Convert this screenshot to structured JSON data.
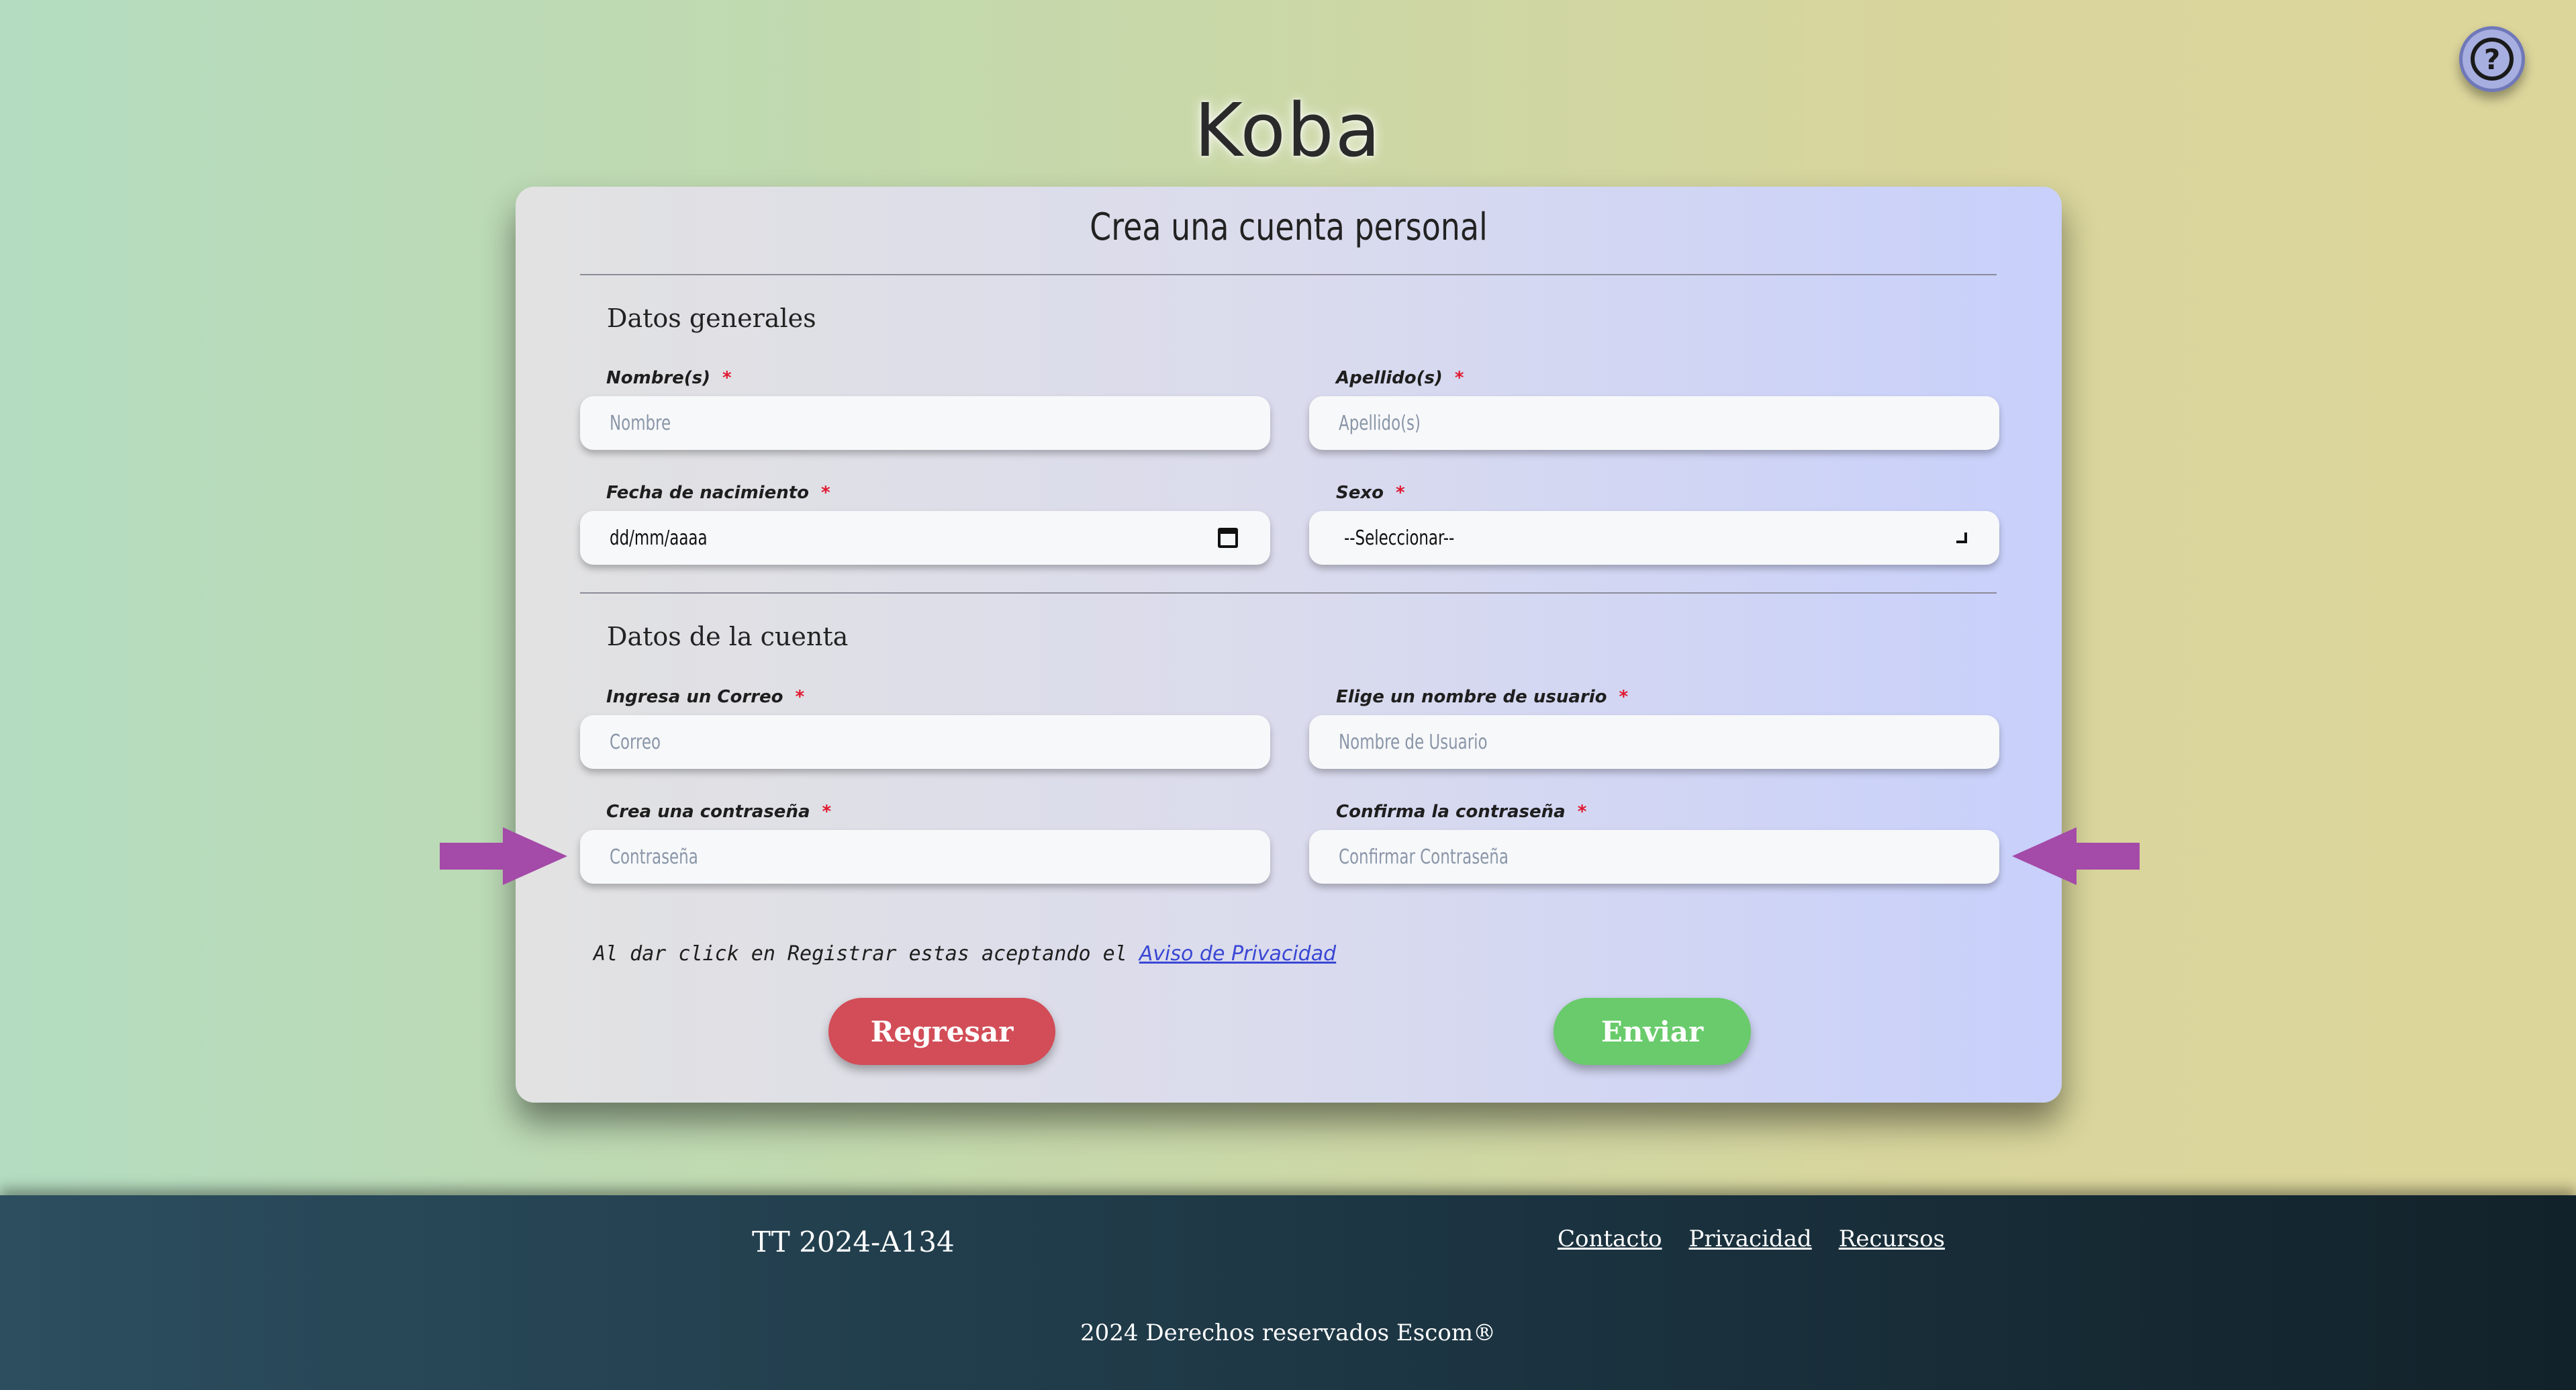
{
  "app": {
    "logo": "Koba",
    "help_label": "?"
  },
  "form": {
    "title": "Crea una cuenta personal",
    "section_general": "Datos generales",
    "section_account": "Datos de la cuenta",
    "required_mark": "*",
    "fields": {
      "first_name": {
        "label": "Nombre(s)",
        "placeholder": "Nombre",
        "value": ""
      },
      "last_name": {
        "label": "Apellido(s)",
        "placeholder": "Apellido(s)",
        "value": ""
      },
      "birth_date": {
        "label": "Fecha de nacimiento",
        "value": "dd/mm/aaaa"
      },
      "sex": {
        "label": "Sexo",
        "value": "--Seleccionar--"
      },
      "email": {
        "label": "Ingresa un Correo",
        "placeholder": "Correo",
        "value": ""
      },
      "username": {
        "label": "Elige un nombre de usuario",
        "placeholder": "Nombre de Usuario",
        "value": ""
      },
      "password": {
        "label": "Crea una contraseña",
        "placeholder": "Contraseña",
        "value": ""
      },
      "confirm_password": {
        "label": "Confirma la contraseña",
        "placeholder": "Confirmar Contraseña",
        "value": ""
      }
    },
    "privacy_text": "Al dar click en Registrar estas aceptando el",
    "privacy_link": "Aviso de Privacidad",
    "back_label": "Regresar",
    "submit_label": "Enviar"
  },
  "annotations": {
    "arrow_color": "#a44aa8",
    "arrows": [
      "arrow-right-icon",
      "arrow-left-icon"
    ]
  },
  "footer": {
    "project": "TT 2024-A134",
    "links": [
      "Contacto",
      "Privacidad",
      "Recursos"
    ],
    "copyright": "2024 Derechos reservados Escom®"
  }
}
